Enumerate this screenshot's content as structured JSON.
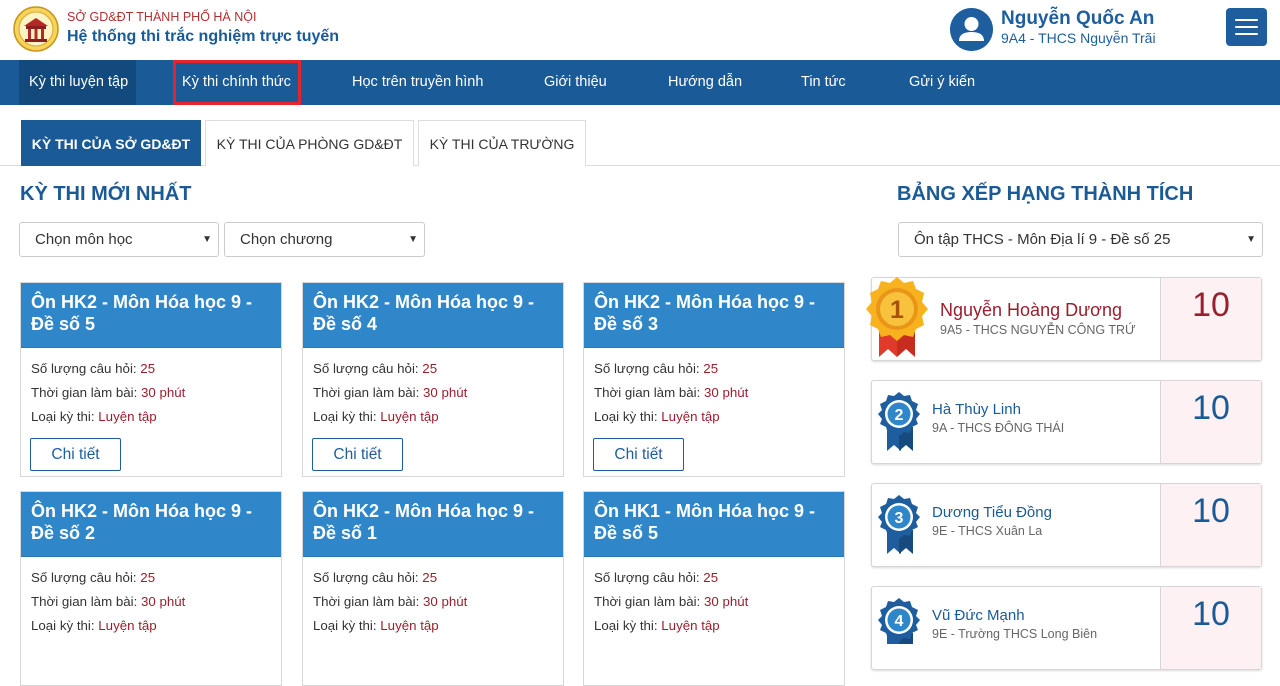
{
  "header": {
    "org_name": "SỞ GD&ĐT THÀNH PHỐ HÀ NỘI",
    "system_name": "Hệ thống thi trắc nghiệm trực tuyến",
    "user": {
      "name": "Nguyễn Quốc An",
      "class": "9A4 - THCS Nguyễn Trãi"
    }
  },
  "nav": {
    "items": [
      {
        "label": "Kỳ thi luyện tập"
      },
      {
        "label": "Kỳ thi chính thức"
      },
      {
        "label": "Học trên truyền hình"
      },
      {
        "label": "Giới thiệu"
      },
      {
        "label": "Hướng dẫn"
      },
      {
        "label": "Tin tức"
      },
      {
        "label": "Gửi ý kiến"
      }
    ]
  },
  "tabs": [
    {
      "label": "KỲ THI CỦA SỞ GD&ĐT"
    },
    {
      "label": "KỲ THI CỦA PHÒNG GD&ĐT"
    },
    {
      "label": "KỲ THI CỦA TRƯỜNG"
    }
  ],
  "latest": {
    "title": "KỲ THI MỚI NHẤT",
    "subject_select": "Chọn môn học",
    "chapter_select": "Chọn chương",
    "labels": {
      "questions": "Số lượng câu hỏi:",
      "time": "Thời gian làm bài:",
      "type": "Loại kỳ thi:",
      "detail": "Chi tiết"
    },
    "cards": [
      {
        "title": "Ôn HK2 - Môn Hóa học 9 - Đề số 5",
        "questions": "25",
        "time": "30 phút",
        "type": "Luyện tập"
      },
      {
        "title": "Ôn HK2 - Môn Hóa học 9 - Đề số 4",
        "questions": "25",
        "time": "30 phút",
        "type": "Luyện tập"
      },
      {
        "title": "Ôn HK2 - Môn Hóa học 9 - Đề số 3",
        "questions": "25",
        "time": "30 phút",
        "type": "Luyện tập"
      },
      {
        "title": "Ôn HK2 - Môn Hóa học 9 - Đề số 2",
        "questions": "25",
        "time": "30 phút",
        "type": "Luyện tập"
      },
      {
        "title": "Ôn HK2 - Môn Hóa học 9 - Đề số 1",
        "questions": "25",
        "time": "30 phút",
        "type": "Luyện tập"
      },
      {
        "title": "Ôn HK1 - Môn Hóa học 9 - Đề số 5",
        "questions": "25",
        "time": "30 phút",
        "type": "Luyện tập"
      }
    ]
  },
  "leaderboard": {
    "title": "BẢNG XẾP HẠNG THÀNH TÍCH",
    "exam_select": "Ôn tập THCS - Môn Địa lí 9 - Đề số 25",
    "entries": [
      {
        "rank": "1",
        "name": "Nguyễn Hoàng Dương",
        "school": "9A5 - THCS NGUYỄN CÔNG TRỨ",
        "score": "10"
      },
      {
        "rank": "2",
        "name": "Hà Thùy Linh",
        "school": "9A - THCS ĐÔNG THÁI",
        "score": "10"
      },
      {
        "rank": "3",
        "name": "Dương Tiểu Đồng",
        "school": "9E - THCS Xuân La",
        "score": "10"
      },
      {
        "rank": "4",
        "name": "Vũ Đức Mạnh",
        "school": "9E - Trường THCS Long Biên",
        "score": "10"
      }
    ]
  },
  "colors": {
    "primary": "#1a5a96",
    "card_header": "#2f86c9",
    "value_red": "#9a1f2d",
    "highlight_red": "#e5252d",
    "gold": "#f2a51b"
  },
  "icons": {
    "logo": "temple-logo-icon",
    "avatar": "user-avatar-icon",
    "menu": "hamburger-menu-icon",
    "select": "caret-down-icon",
    "medal": "award-medal-icon"
  }
}
